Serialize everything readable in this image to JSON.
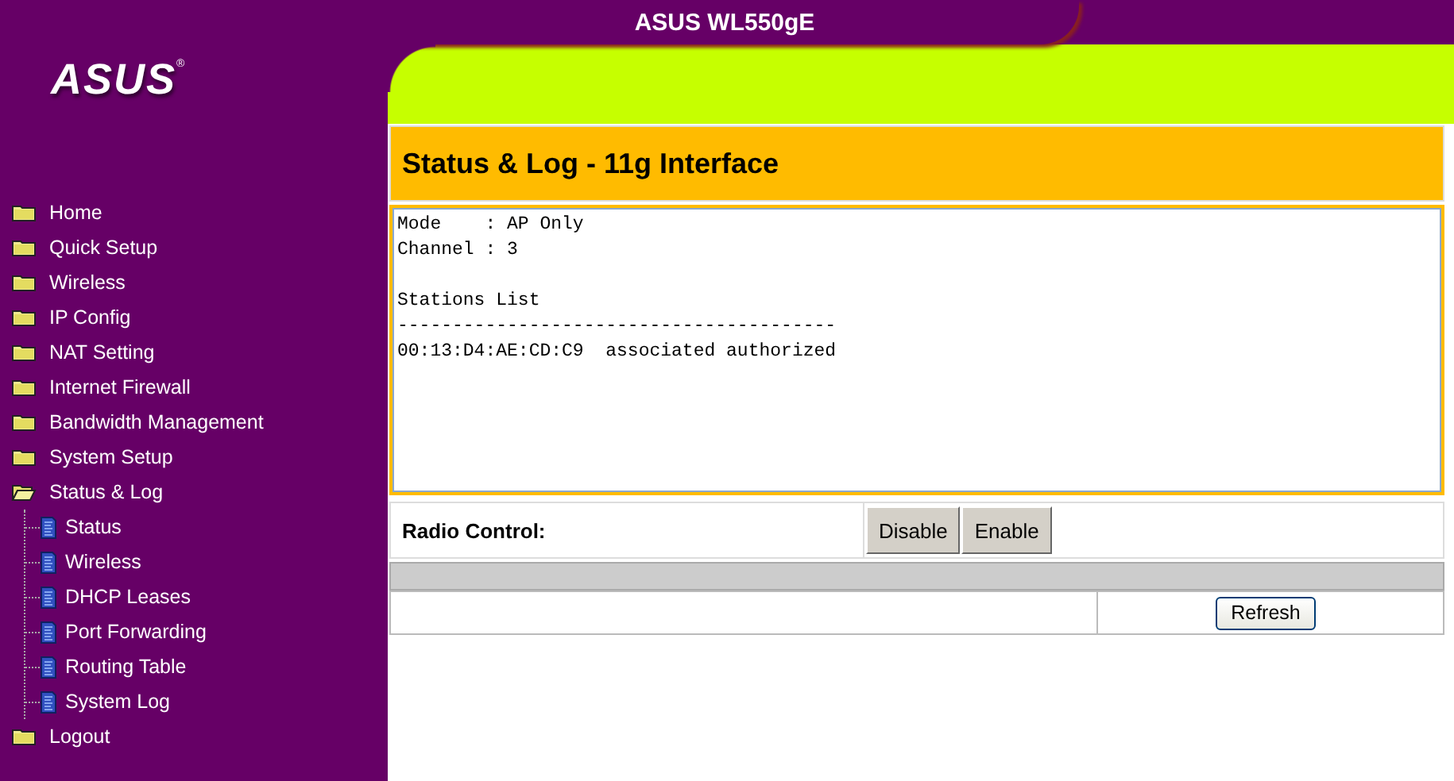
{
  "header": {
    "title": "ASUS WL550gE",
    "logo": "ASUS",
    "logo_mark": "®"
  },
  "menu": [
    {
      "label": "Home",
      "expanded": false
    },
    {
      "label": "Quick Setup",
      "expanded": false
    },
    {
      "label": "Wireless",
      "expanded": false
    },
    {
      "label": "IP Config",
      "expanded": false
    },
    {
      "label": "NAT Setting",
      "expanded": false
    },
    {
      "label": "Internet Firewall",
      "expanded": false
    },
    {
      "label": "Bandwidth Management",
      "expanded": false
    },
    {
      "label": "System Setup",
      "expanded": false
    },
    {
      "label": "Status & Log",
      "expanded": true,
      "children": [
        {
          "label": "Status"
        },
        {
          "label": "Wireless"
        },
        {
          "label": "DHCP Leases"
        },
        {
          "label": "Port Forwarding"
        },
        {
          "label": "Routing Table"
        },
        {
          "label": "System Log"
        }
      ]
    },
    {
      "label": "Logout",
      "expanded": false
    }
  ],
  "page_title": "Status & Log - 11g Interface",
  "log_text": "Mode    : AP Only\nChannel : 3\n\nStations List\n----------------------------------------\n00:13:D4:AE:CD:C9  associated authorized",
  "radio_control": {
    "label": "Radio Control:",
    "buttons": [
      "Disable",
      "Enable"
    ]
  },
  "refresh_button": "Refresh"
}
